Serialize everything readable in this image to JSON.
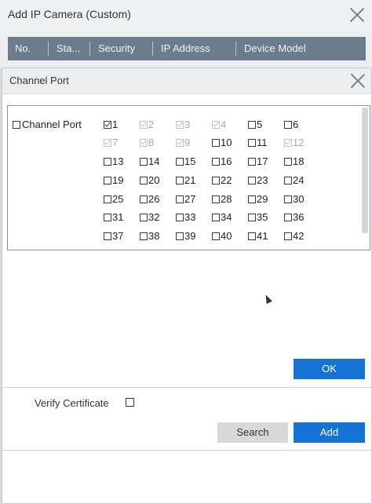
{
  "outer": {
    "title": "Add IP Camera (Custom)",
    "columns": [
      "No.",
      "Sta...",
      "Security",
      "IP Address",
      "Device Model"
    ]
  },
  "dialog": {
    "title": "Channel Port",
    "channel_port_label": "Channel Port",
    "channel_port_checked": false,
    "channels": [
      {
        "label": "1",
        "checked": true,
        "disabled": false
      },
      {
        "label": "2",
        "checked": true,
        "disabled": true
      },
      {
        "label": "3",
        "checked": true,
        "disabled": true
      },
      {
        "label": "4",
        "checked": true,
        "disabled": true
      },
      {
        "label": "5",
        "checked": false,
        "disabled": false
      },
      {
        "label": "6",
        "checked": false,
        "disabled": false
      },
      {
        "label": "7",
        "checked": true,
        "disabled": true
      },
      {
        "label": "8",
        "checked": true,
        "disabled": true
      },
      {
        "label": "9",
        "checked": true,
        "disabled": true
      },
      {
        "label": "10",
        "checked": false,
        "disabled": false
      },
      {
        "label": "11",
        "checked": false,
        "disabled": false
      },
      {
        "label": "12",
        "checked": true,
        "disabled": true
      },
      {
        "label": "13",
        "checked": false,
        "disabled": false
      },
      {
        "label": "14",
        "checked": false,
        "disabled": false
      },
      {
        "label": "15",
        "checked": false,
        "disabled": false
      },
      {
        "label": "16",
        "checked": false,
        "disabled": false
      },
      {
        "label": "17",
        "checked": false,
        "disabled": false
      },
      {
        "label": "18",
        "checked": false,
        "disabled": false
      },
      {
        "label": "19",
        "checked": false,
        "disabled": false
      },
      {
        "label": "20",
        "checked": false,
        "disabled": false
      },
      {
        "label": "21",
        "checked": false,
        "disabled": false
      },
      {
        "label": "22",
        "checked": false,
        "disabled": false
      },
      {
        "label": "23",
        "checked": false,
        "disabled": false
      },
      {
        "label": "24",
        "checked": false,
        "disabled": false
      },
      {
        "label": "25",
        "checked": false,
        "disabled": false
      },
      {
        "label": "26",
        "checked": false,
        "disabled": false
      },
      {
        "label": "27",
        "checked": false,
        "disabled": false
      },
      {
        "label": "28",
        "checked": false,
        "disabled": false
      },
      {
        "label": "29",
        "checked": false,
        "disabled": false
      },
      {
        "label": "30",
        "checked": false,
        "disabled": false
      },
      {
        "label": "31",
        "checked": false,
        "disabled": false
      },
      {
        "label": "32",
        "checked": false,
        "disabled": false
      },
      {
        "label": "33",
        "checked": false,
        "disabled": false
      },
      {
        "label": "34",
        "checked": false,
        "disabled": false
      },
      {
        "label": "35",
        "checked": false,
        "disabled": false
      },
      {
        "label": "36",
        "checked": false,
        "disabled": false
      },
      {
        "label": "37",
        "checked": false,
        "disabled": false
      },
      {
        "label": "38",
        "checked": false,
        "disabled": false
      },
      {
        "label": "39",
        "checked": false,
        "disabled": false
      },
      {
        "label": "40",
        "checked": false,
        "disabled": false
      },
      {
        "label": "41",
        "checked": false,
        "disabled": false
      },
      {
        "label": "42",
        "checked": false,
        "disabled": false
      }
    ],
    "ok_label": "OK"
  },
  "footer": {
    "verify_certificate_label": "Verify Certificate",
    "verify_certificate_checked": false,
    "search_label": "Search",
    "add_label": "Add"
  },
  "colors": {
    "primary": "#1573d8",
    "header_bg": "#6a7c8d",
    "dialog_bg": "#ffffff"
  },
  "icons": [
    "close-icon",
    "checkbox-icon",
    "cursor-icon"
  ]
}
